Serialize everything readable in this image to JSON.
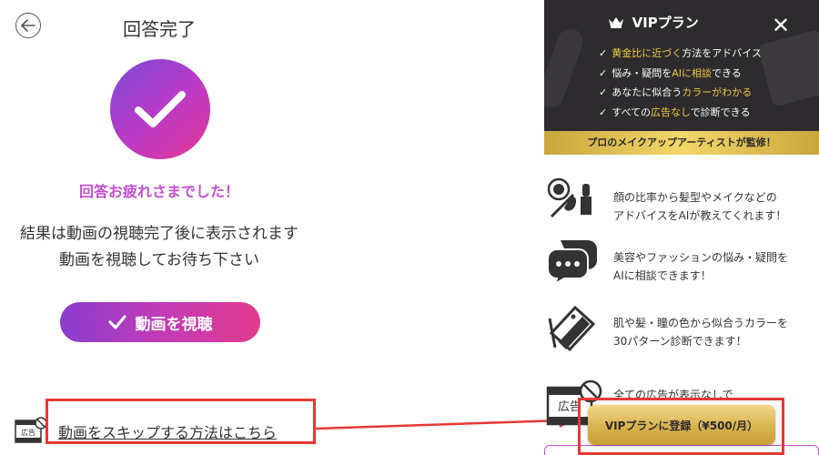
{
  "left": {
    "title": "回答完了",
    "thanks": "回答お疲れさまでした！",
    "result_line1": "結果は動画の視聴完了後に表示されます",
    "result_line2": "動画を視聴してお待ち下さい",
    "watch_button": "動画を視聴",
    "ad_badge": "広告",
    "skip_link": "動画をスキップする方法はこちら"
  },
  "banner": {
    "title": "VIPプラン",
    "close": "✕",
    "items": [
      {
        "pre": "",
        "hl": "黄金比に近づく",
        "post": "方法をアドバイス"
      },
      {
        "pre": "悩み・疑問を",
        "hl": "AIに相談",
        "post": "できる"
      },
      {
        "pre": "あなたに似合う",
        "hl": "カラーがわかる",
        "post": ""
      },
      {
        "pre": "すべての",
        "hl": "広告なし",
        "post": "で診断できる"
      }
    ],
    "footer": "プロのメイクアップアーティストが監修！"
  },
  "features": [
    {
      "line1": "顔の比率から髪型やメイクなどの",
      "line2": "アドバイスをAIが教えてくれます！"
    },
    {
      "line1": "美容やファッションの悩み・疑問を",
      "line2": "AIに相談できます！"
    },
    {
      "line1": "肌や髪・瞳の色から似合うカラーを",
      "line2": "30パターン診断できます！"
    },
    {
      "line1": "全ての広告が表示なしで",
      "line2": ""
    }
  ],
  "vip_button": "VIPプランに登録（¥500/月）",
  "colors": {
    "accent_purple": "#c44fd2",
    "gold": "#d8b34e",
    "highlight_red": "#e53935"
  }
}
